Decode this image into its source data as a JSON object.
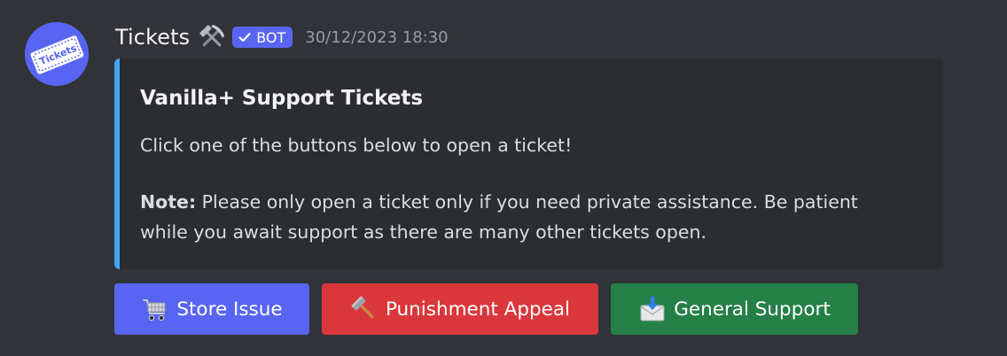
{
  "message": {
    "author": {
      "name": "Tickets",
      "badge_emoji": "hammer-and-pick-icon",
      "bot_tag": "BOT",
      "avatar_text": "Tickets"
    },
    "timestamp": "30/12/2023 18:30"
  },
  "embed": {
    "accent_color": "#41a5f5",
    "title": "Vanilla+ Support Tickets",
    "line1": "Click one of the buttons below to open a ticket!",
    "note_label": "Note:",
    "note_text": " Please only open a ticket only if you need private assistance. Be patient",
    "note_text2": "while you await support as there are many other tickets open."
  },
  "buttons": [
    {
      "label": "Store Issue",
      "icon": "shopping-cart-icon",
      "color": "#5865f2"
    },
    {
      "label": "Punishment Appeal",
      "icon": "hammer-icon",
      "color": "#da373c"
    },
    {
      "label": "General Support",
      "icon": "envelope-with-arrow-icon",
      "color": "#248046"
    }
  ],
  "colors": {
    "background": "#313338",
    "embed_background": "#2b2d31",
    "blurple": "#5865f2"
  }
}
